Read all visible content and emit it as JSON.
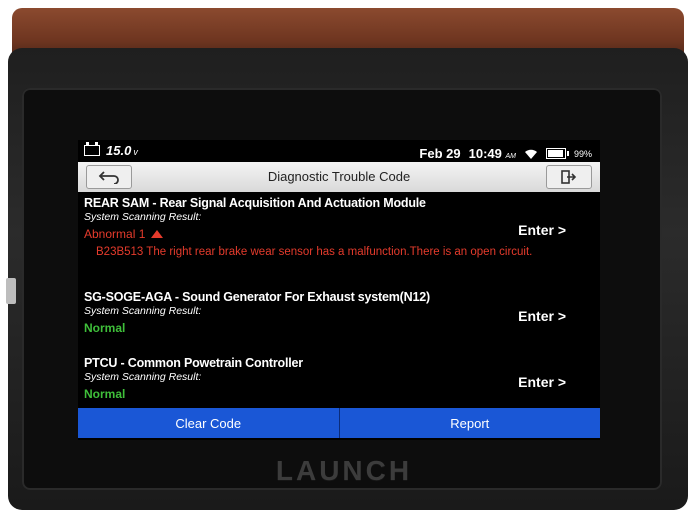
{
  "device": {
    "brand": "LAUNCH"
  },
  "status_bar": {
    "voltage": "15.0",
    "voltage_unit": "v",
    "date": "Feb 29",
    "time": "10:49",
    "ampm": "AM",
    "battery_pct": "99%"
  },
  "header": {
    "title": "Diagnostic Trouble Code"
  },
  "modules": [
    {
      "name": "REAR SAM - Rear Signal Acquisition And Actuation Module",
      "scan_label": "System Scanning Result:",
      "status": "Abnormal 1",
      "status_type": "abnormal",
      "dtc": "B23B513 The right rear brake wear sensor has a malfunction.There is an open circuit.",
      "enter": "Enter >"
    },
    {
      "name": "SG-SOGE-AGA - Sound Generator For Exhaust system(N12)",
      "scan_label": "System Scanning Result:",
      "status": "Normal",
      "status_type": "normal",
      "enter": "Enter >"
    },
    {
      "name": "PTCU - Common Powetrain Controller",
      "scan_label": "System Scanning Result:",
      "status": "Normal",
      "status_type": "normal",
      "enter": "Enter >"
    }
  ],
  "actions": {
    "clear_code": "Clear Code",
    "report": "Report"
  },
  "colors": {
    "abnormal": "#e53b2c",
    "normal": "#3fbf3a",
    "button": "#1a57d6"
  }
}
